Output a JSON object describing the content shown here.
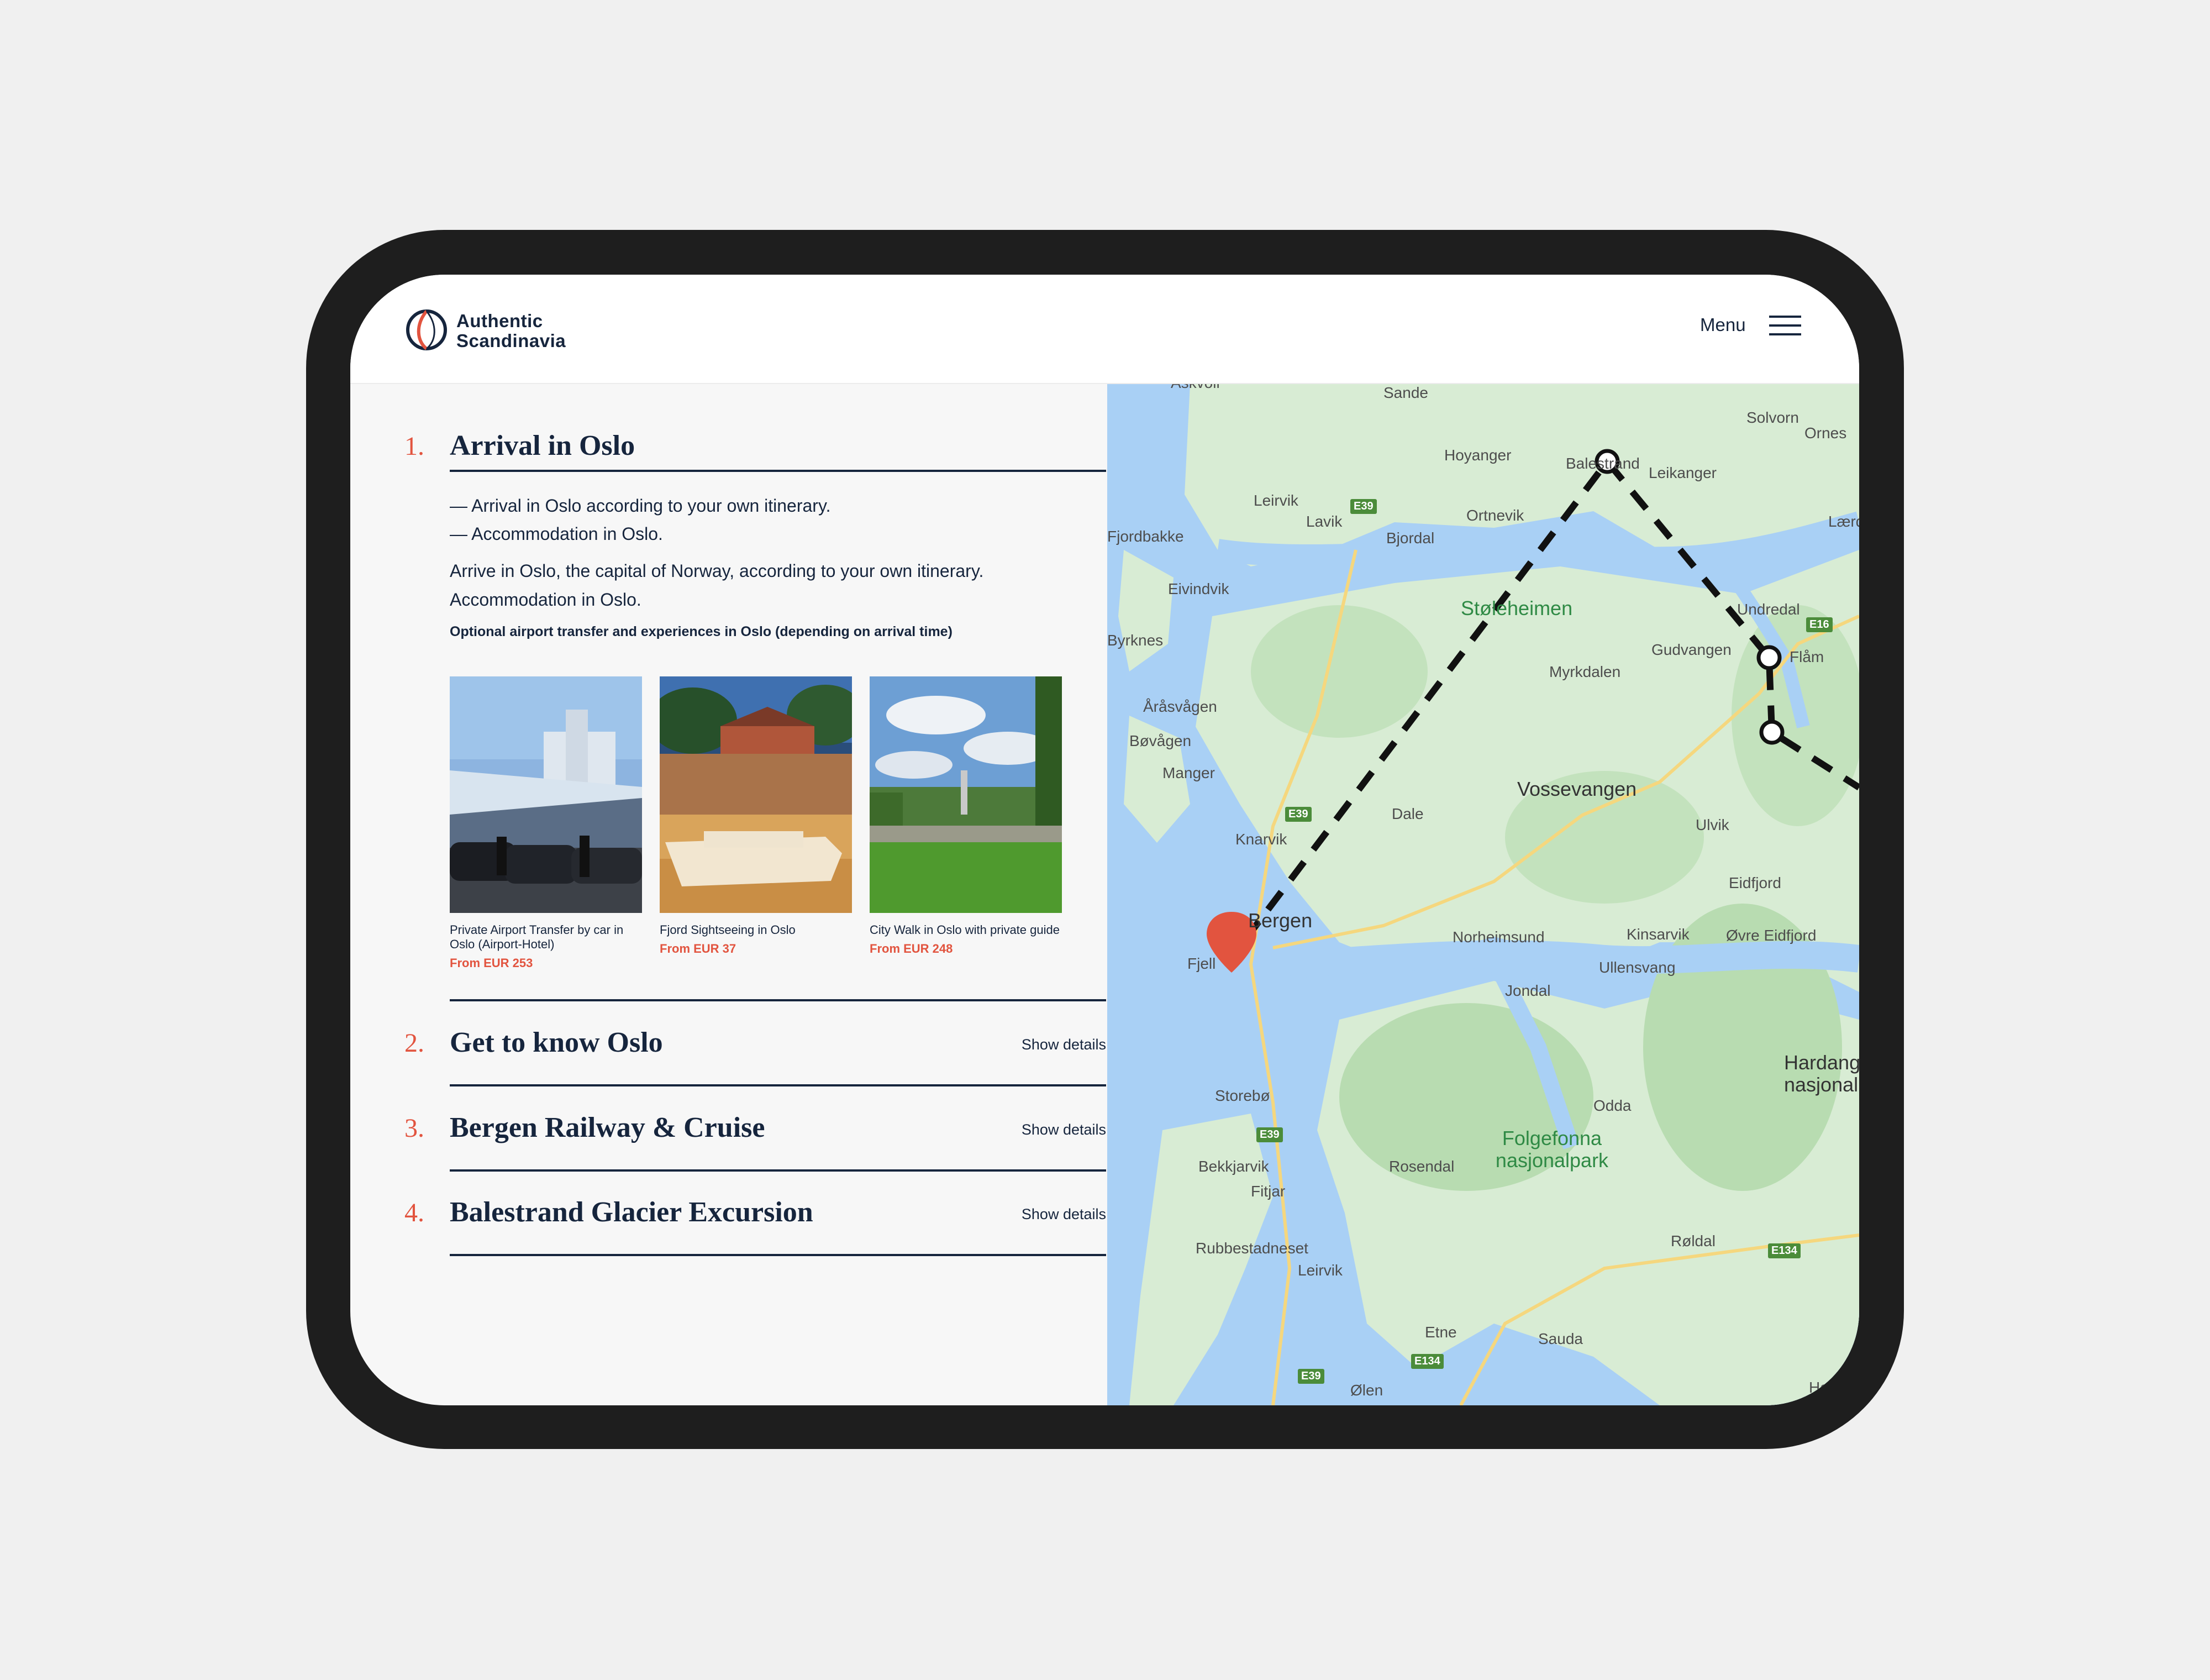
{
  "brand": {
    "line1": "Authentic",
    "line2": "Scandinavia"
  },
  "header": {
    "menu_label": "Menu"
  },
  "steps": [
    {
      "number": "1.",
      "title": "Arrival in Oslo",
      "bullets": [
        "— Arrival in Oslo according to your own itinerary.",
        "— Accommodation in Oslo."
      ],
      "description_line1": "Arrive in Oslo, the capital of Norway, according to your own itinerary.",
      "description_line2": "Accommodation in Oslo.",
      "optional_note": "Optional airport transfer and experiences in Oslo (depending on arrival time)",
      "cards": [
        {
          "caption": "Private Airport Transfer by car in Oslo (Airport-Hotel)",
          "price": "From EUR 253"
        },
        {
          "caption": "Fjord Sightseeing in Oslo",
          "price": "From EUR 37"
        },
        {
          "caption": "City Walk in Oslo with private guide",
          "price": "From EUR 248"
        }
      ]
    },
    {
      "number": "2.",
      "title": "Get to know Oslo",
      "toggle": "Show details"
    },
    {
      "number": "3.",
      "title": "Bergen Railway & Cruise",
      "toggle": "Show details"
    },
    {
      "number": "4.",
      "title": "Balestrand Glacier Excursion",
      "toggle": "Show details"
    }
  ],
  "map": {
    "places": [
      "Askvoll",
      "Sande",
      "Solvorn",
      "Ornes",
      "Hoyanger",
      "Balestrand",
      "Leikanger",
      "Lærdal",
      "Fjordbakke",
      "Leirvik",
      "Lavik",
      "Ortnevik",
      "Bjordal",
      "Eivindvik",
      "Støleheimen",
      "Undredal",
      "Byrknes",
      "Gudvangen",
      "Flåm",
      "Myrkdalen",
      "Åråsvågen",
      "Bøvågen",
      "Manger",
      "Vossevangen",
      "Dale",
      "Ulvik",
      "Knarvik",
      "Eidfjord",
      "Bergen",
      "Norheimsund",
      "Kinsarvik",
      "Øvre Eidfjord",
      "Fjell",
      "Ullensvang",
      "Jondal",
      "Hardangervidda nasjonalpark",
      "Storebø",
      "Odda",
      "Folgefonna nasjonalpark",
      "Bekkjarvik",
      "Rosendal",
      "Fitjar",
      "Røldal",
      "Rubbestadneset",
      "Leirvik",
      "Etne",
      "Sauda",
      "Ølen",
      "Hovden"
    ],
    "roads": [
      "E39",
      "E16",
      "E39",
      "E39",
      "E134",
      "E134",
      "E39"
    ]
  },
  "colors": {
    "accent": "#e2543f",
    "navy": "#16253d",
    "device": "#1e1e1e"
  }
}
